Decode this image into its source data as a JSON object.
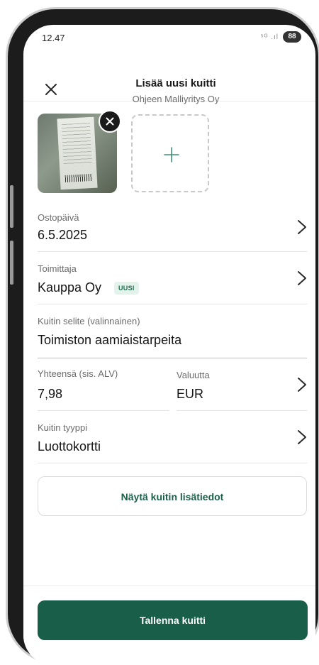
{
  "status_bar": {
    "time": "12.47",
    "signal": "⁵ᴳ .ıl",
    "battery": "88"
  },
  "header": {
    "title": "Lisää uusi kuitti",
    "subtitle": "Ohjeen Malliyritys Oy"
  },
  "icons": {
    "close": "close-icon",
    "remove_photo": "close-icon",
    "add_photo": "plus-icon",
    "chevron": "chevron-right-icon"
  },
  "form": {
    "purchase_date": {
      "label": "Ostopäivä",
      "value": "6.5.2025"
    },
    "supplier": {
      "label": "Toimittaja",
      "value": "Kauppa Oy",
      "badge": "UUSI"
    },
    "description": {
      "label": "Kuitin selite (valinnainen)",
      "value": "Toimiston aamiaistarpeita"
    },
    "total": {
      "label": "Yhteensä (sis. ALV)",
      "value": "7,98"
    },
    "currency": {
      "label": "Valuutta",
      "value": "EUR"
    },
    "receipt_type": {
      "label": "Kuitin tyyppi",
      "value": "Luottokortti"
    }
  },
  "buttons": {
    "show_details": "Näytä kuitin lisätiedot",
    "save": "Tallenna kuitti"
  },
  "colors": {
    "primary": "#185e48",
    "accent_text": "#1b5e47",
    "badge_bg": "#e3f3ec",
    "plus_icon": "#3f8f73"
  }
}
